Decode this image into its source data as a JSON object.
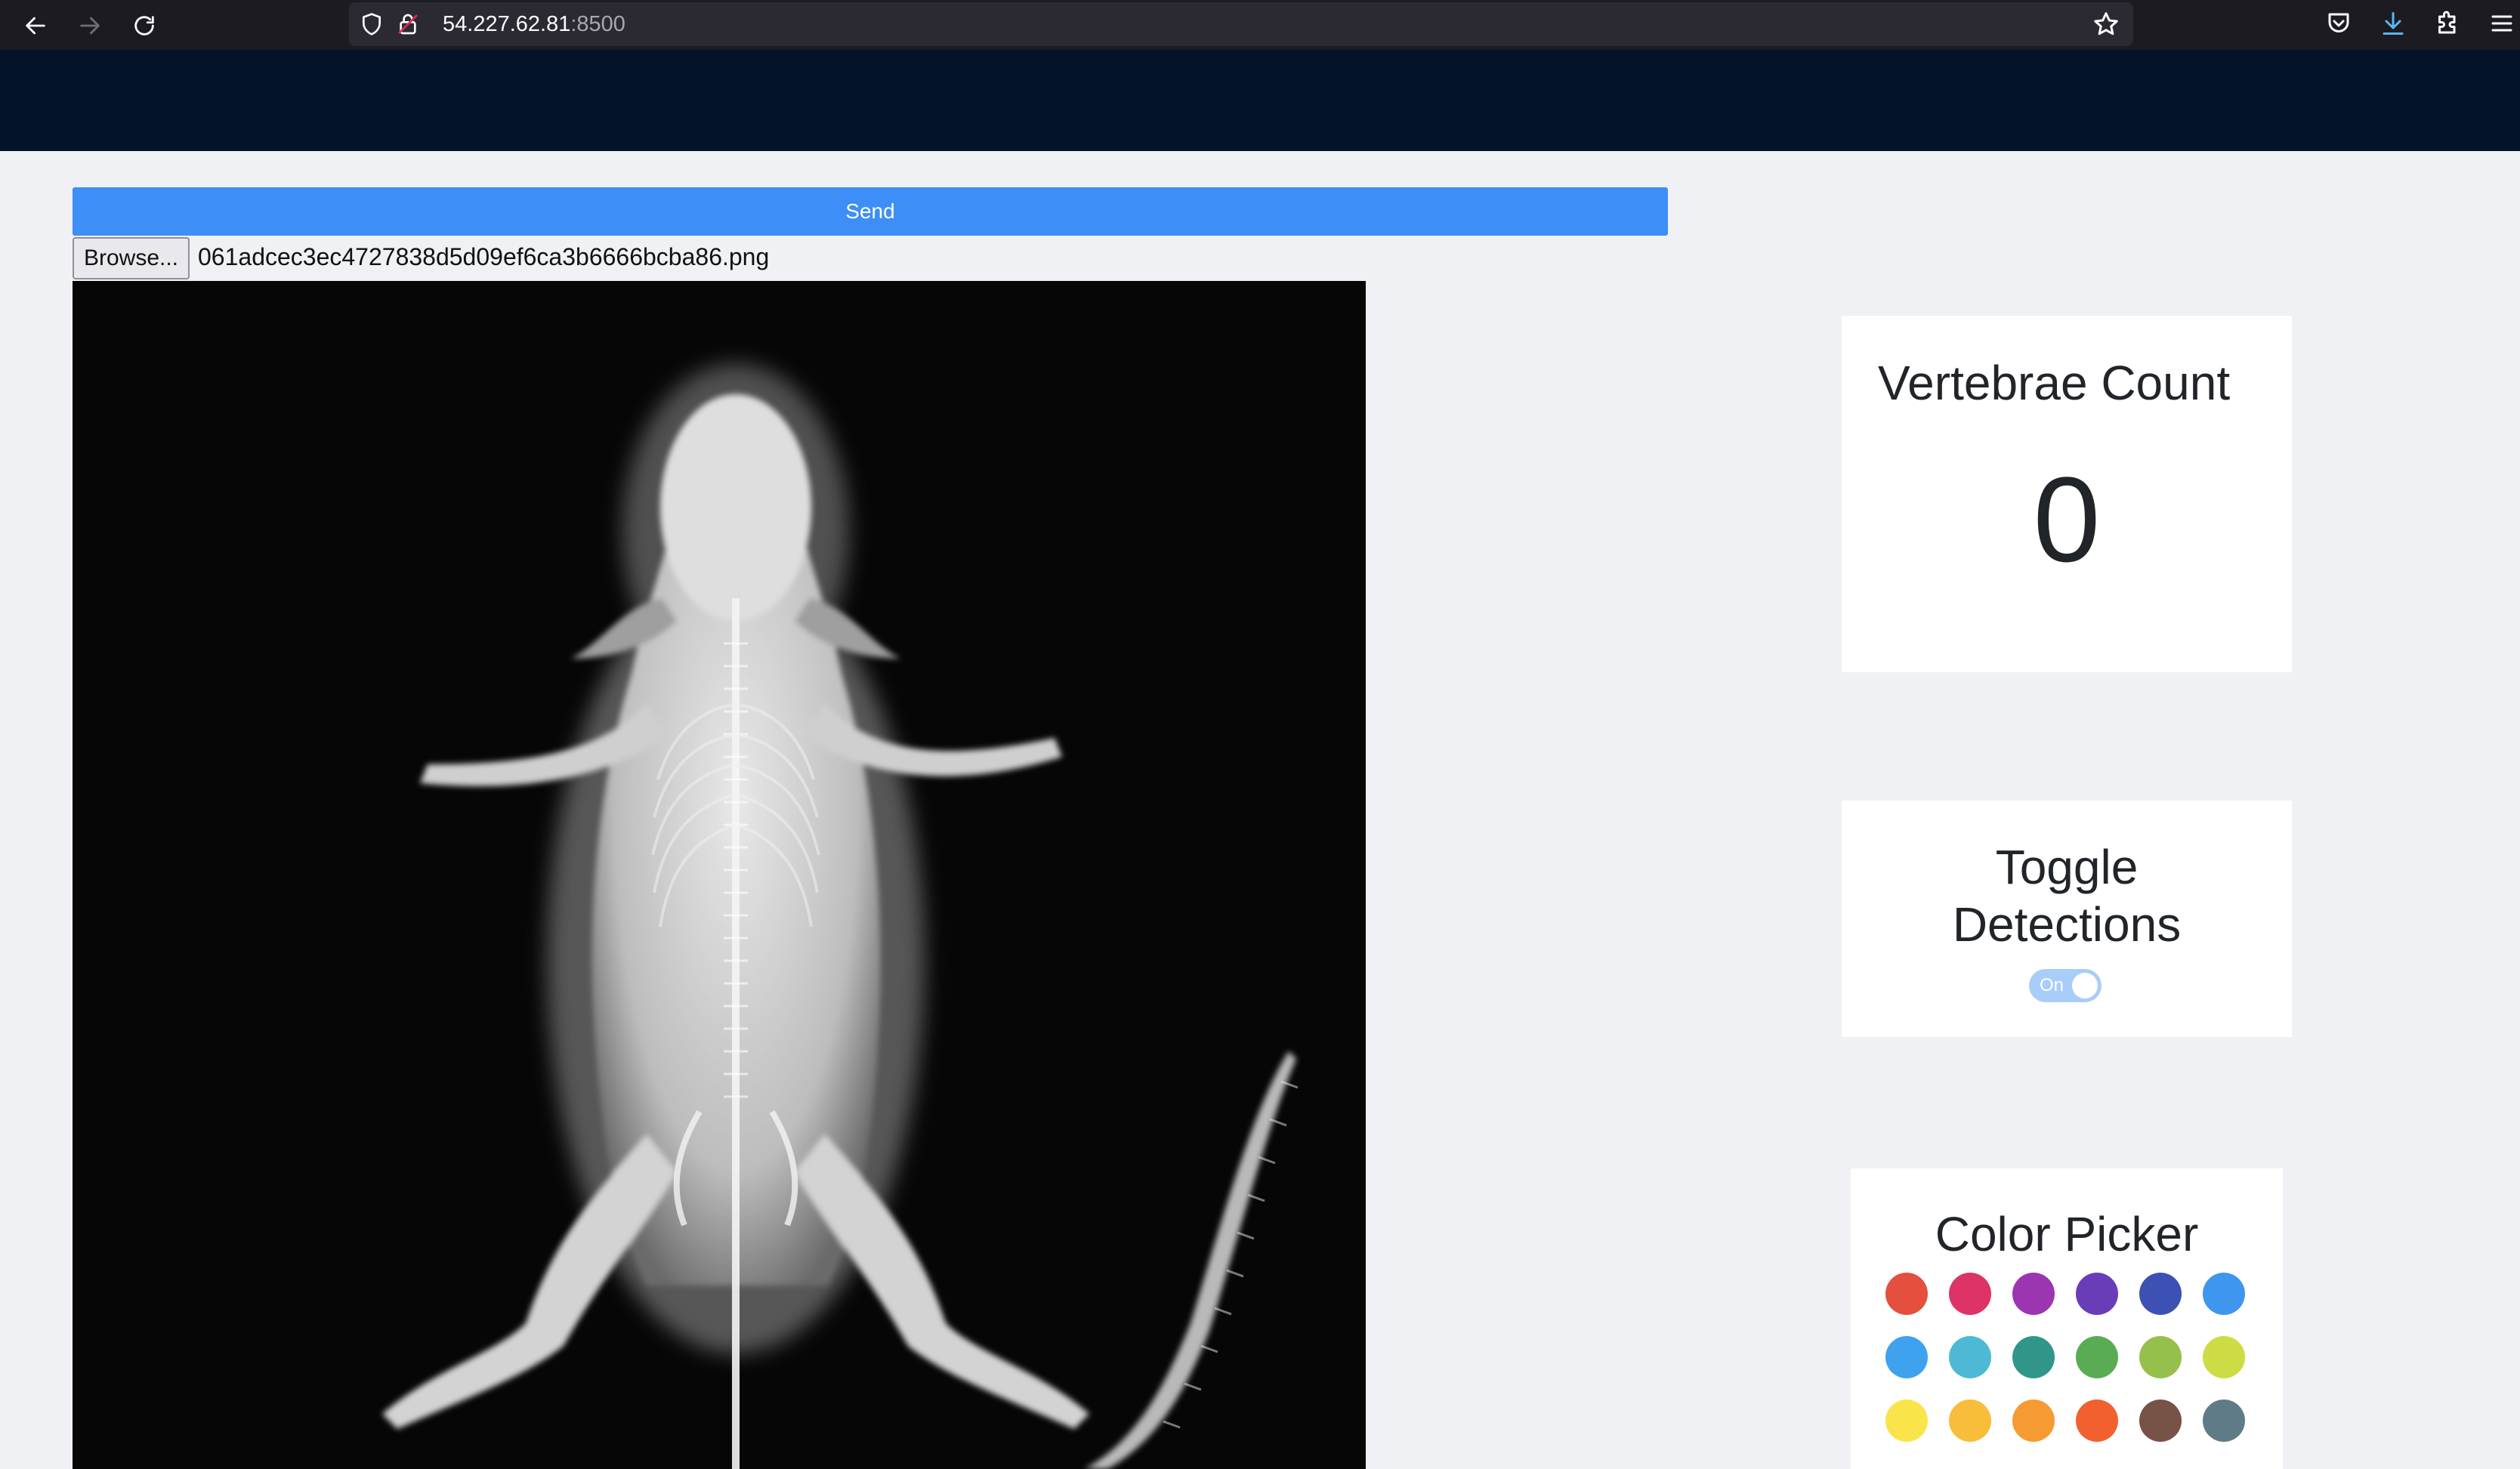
{
  "browser": {
    "url_host": "54.227.62.81",
    "url_port": ":8500",
    "icons": [
      "back-arrow-icon",
      "forward-arrow-icon",
      "reload-icon",
      "shield-icon",
      "lock-icon",
      "star-icon",
      "pocket-icon",
      "download-icon",
      "extensions-icon",
      "menu-icon"
    ]
  },
  "upload": {
    "send_label": "Send",
    "browse_label": "Browse...",
    "file_name": "061adcec3ec4727838d5d09ef6ca3b6666bcba86.png"
  },
  "vertebrae_card": {
    "title": "Vertebrae Count",
    "count": "0"
  },
  "toggle_card": {
    "title_line1": "Toggle",
    "title_line2": "Detections",
    "switch_label": "On",
    "switch_on": true
  },
  "color_card": {
    "title": "Color Picker",
    "colors": [
      "#e4503d",
      "#dd3366",
      "#9b35b0",
      "#6a3db8",
      "#3d51b4",
      "#3f96ef",
      "#3fa2ef",
      "#4db9d4",
      "#30968a",
      "#5aac54",
      "#95c04c",
      "#cddc44",
      "#fbe34a",
      "#f8bd3a",
      "#f59b31",
      "#f2602f",
      "#775246",
      "#5f7b88"
    ]
  },
  "colors": {
    "header_bg": "#03132a",
    "send_button": "#3d8ef7",
    "page_bg": "#f0f1f5"
  }
}
